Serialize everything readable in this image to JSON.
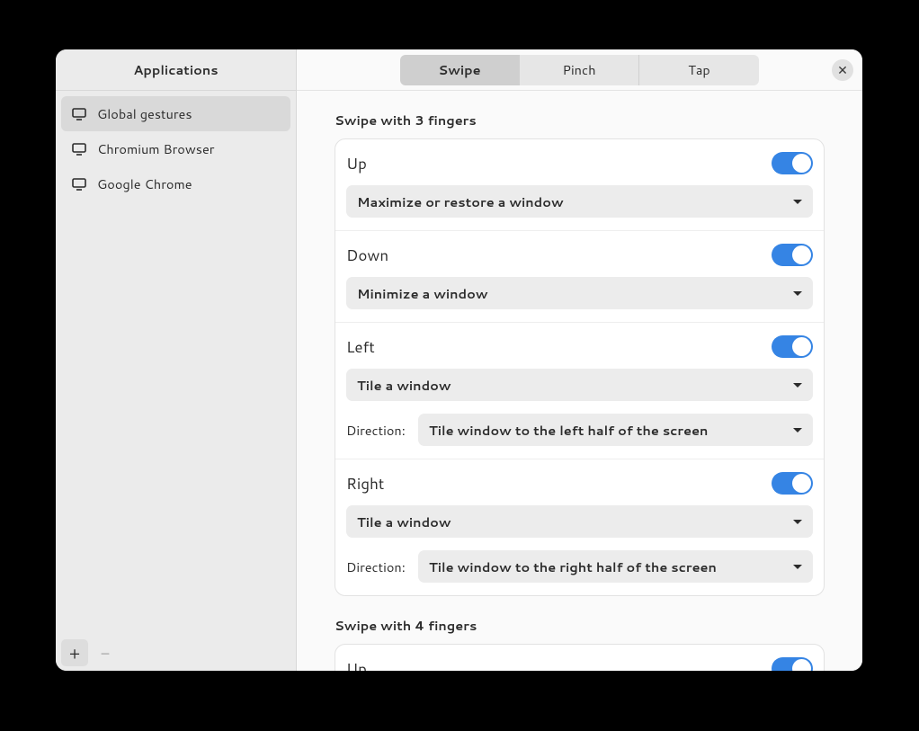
{
  "sidebar": {
    "title": "Applications",
    "items": [
      {
        "label": "Global gestures",
        "active": true
      },
      {
        "label": "Chromium Browser",
        "active": false
      },
      {
        "label": "Google Chrome",
        "active": false
      }
    ],
    "add_tooltip": "Add",
    "remove_tooltip": "Remove"
  },
  "header": {
    "tabs": [
      {
        "label": "Swipe",
        "active": true
      },
      {
        "label": "Pinch",
        "active": false
      },
      {
        "label": "Tap",
        "active": false
      }
    ],
    "close_tooltip": "Close"
  },
  "sections": {
    "three": {
      "title": "Swipe with 3 fingers",
      "direction_label": "Direction:",
      "rows": {
        "up": {
          "title": "Up",
          "enabled": true,
          "action": "Maximize or restore a window"
        },
        "down": {
          "title": "Down",
          "enabled": true,
          "action": "Minimize a window"
        },
        "left": {
          "title": "Left",
          "enabled": true,
          "action": "Tile a window",
          "direction_value": "Tile window to the left half of the screen"
        },
        "right": {
          "title": "Right",
          "enabled": true,
          "action": "Tile a window",
          "direction_value": "Tile window to the right half of the screen"
        }
      }
    },
    "four": {
      "title": "Swipe with 4 fingers",
      "rows": {
        "up": {
          "title": "Up",
          "enabled": true
        }
      }
    }
  }
}
